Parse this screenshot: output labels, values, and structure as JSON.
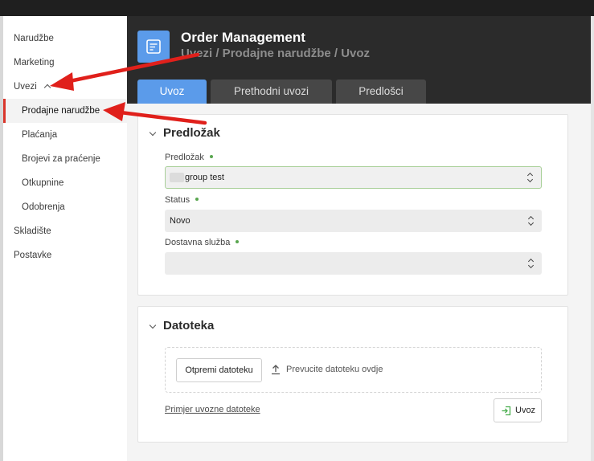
{
  "sidebar": {
    "items": [
      {
        "label": "Narudžbe"
      },
      {
        "label": "Marketing"
      },
      {
        "label": "Uvezi"
      },
      {
        "label": "Prodajne narudžbe"
      },
      {
        "label": "Plaćanja"
      },
      {
        "label": "Brojevi za praćenje"
      },
      {
        "label": "Otkupnine"
      },
      {
        "label": "Odobrenja"
      },
      {
        "label": "Skladište"
      },
      {
        "label": "Postavke"
      }
    ]
  },
  "header": {
    "title": "Order Management",
    "breadcrumb": "Uvezi / Prodajne narudžbe / Uvoz",
    "tabs": [
      {
        "label": "Uvoz"
      },
      {
        "label": "Prethodni uvozi"
      },
      {
        "label": "Predlošci"
      }
    ]
  },
  "template_card": {
    "title": "Predložak",
    "fields": [
      {
        "label": "Predložak",
        "value": "group test"
      },
      {
        "label": "Status",
        "value": "Novo"
      },
      {
        "label": "Dostavna služba",
        "value": ""
      }
    ]
  },
  "file_card": {
    "title": "Datoteka",
    "upload_button": "Otpremi datoteku",
    "drop_hint": "Prevucite datoteku ovdje",
    "sample_link": "Primjer uvozne datoteke",
    "import_button": "Uvoz"
  },
  "colors": {
    "accent": "#5b9bea",
    "header_bg": "#2b2b2b",
    "required_dot": "#59a64f",
    "active_marker": "#d9362b",
    "annotation_arrow": "#e0201b"
  }
}
